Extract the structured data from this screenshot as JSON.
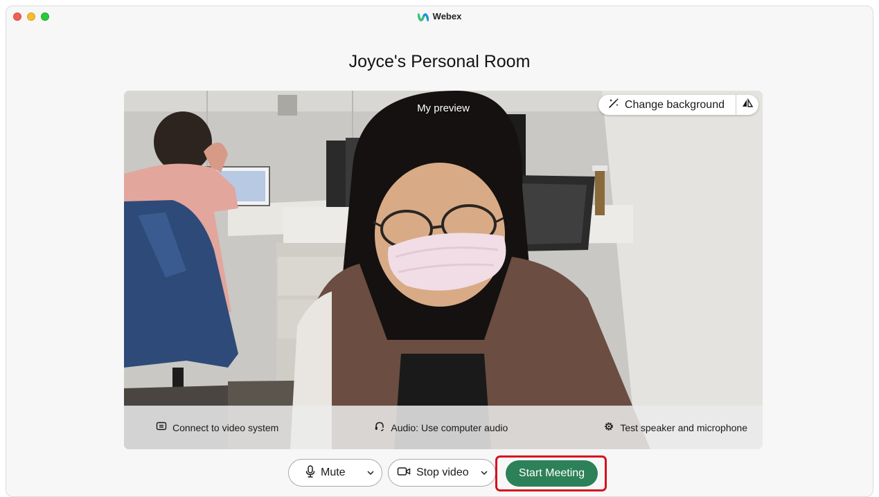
{
  "app": {
    "title": "Webex"
  },
  "room": {
    "title": "Joyce's Personal Room"
  },
  "preview": {
    "label": "My preview",
    "change_background_label": "Change background"
  },
  "options": {
    "connect_label": "Connect to video system",
    "audio_label": "Audio: Use computer audio",
    "test_label": "Test speaker and microphone"
  },
  "controls": {
    "mute_label": "Mute",
    "stop_video_label": "Stop video",
    "start_meeting_label": "Start Meeting"
  },
  "icons": {
    "webex_logo": "webex-logo-icon",
    "change_background": "magic-wand-icon",
    "mirror": "mirror-icon",
    "connect": "screen-cast-icon",
    "audio": "headset-icon",
    "test": "gear-icon",
    "mute": "microphone-icon",
    "video": "camera-icon",
    "dropdown": "chevron-down-icon"
  },
  "colors": {
    "start_button": "#2d8158",
    "highlight_box": "#d7101d",
    "close": "#ee5f57",
    "minimize": "#f5bd2f",
    "maximize": "#2bc840"
  }
}
